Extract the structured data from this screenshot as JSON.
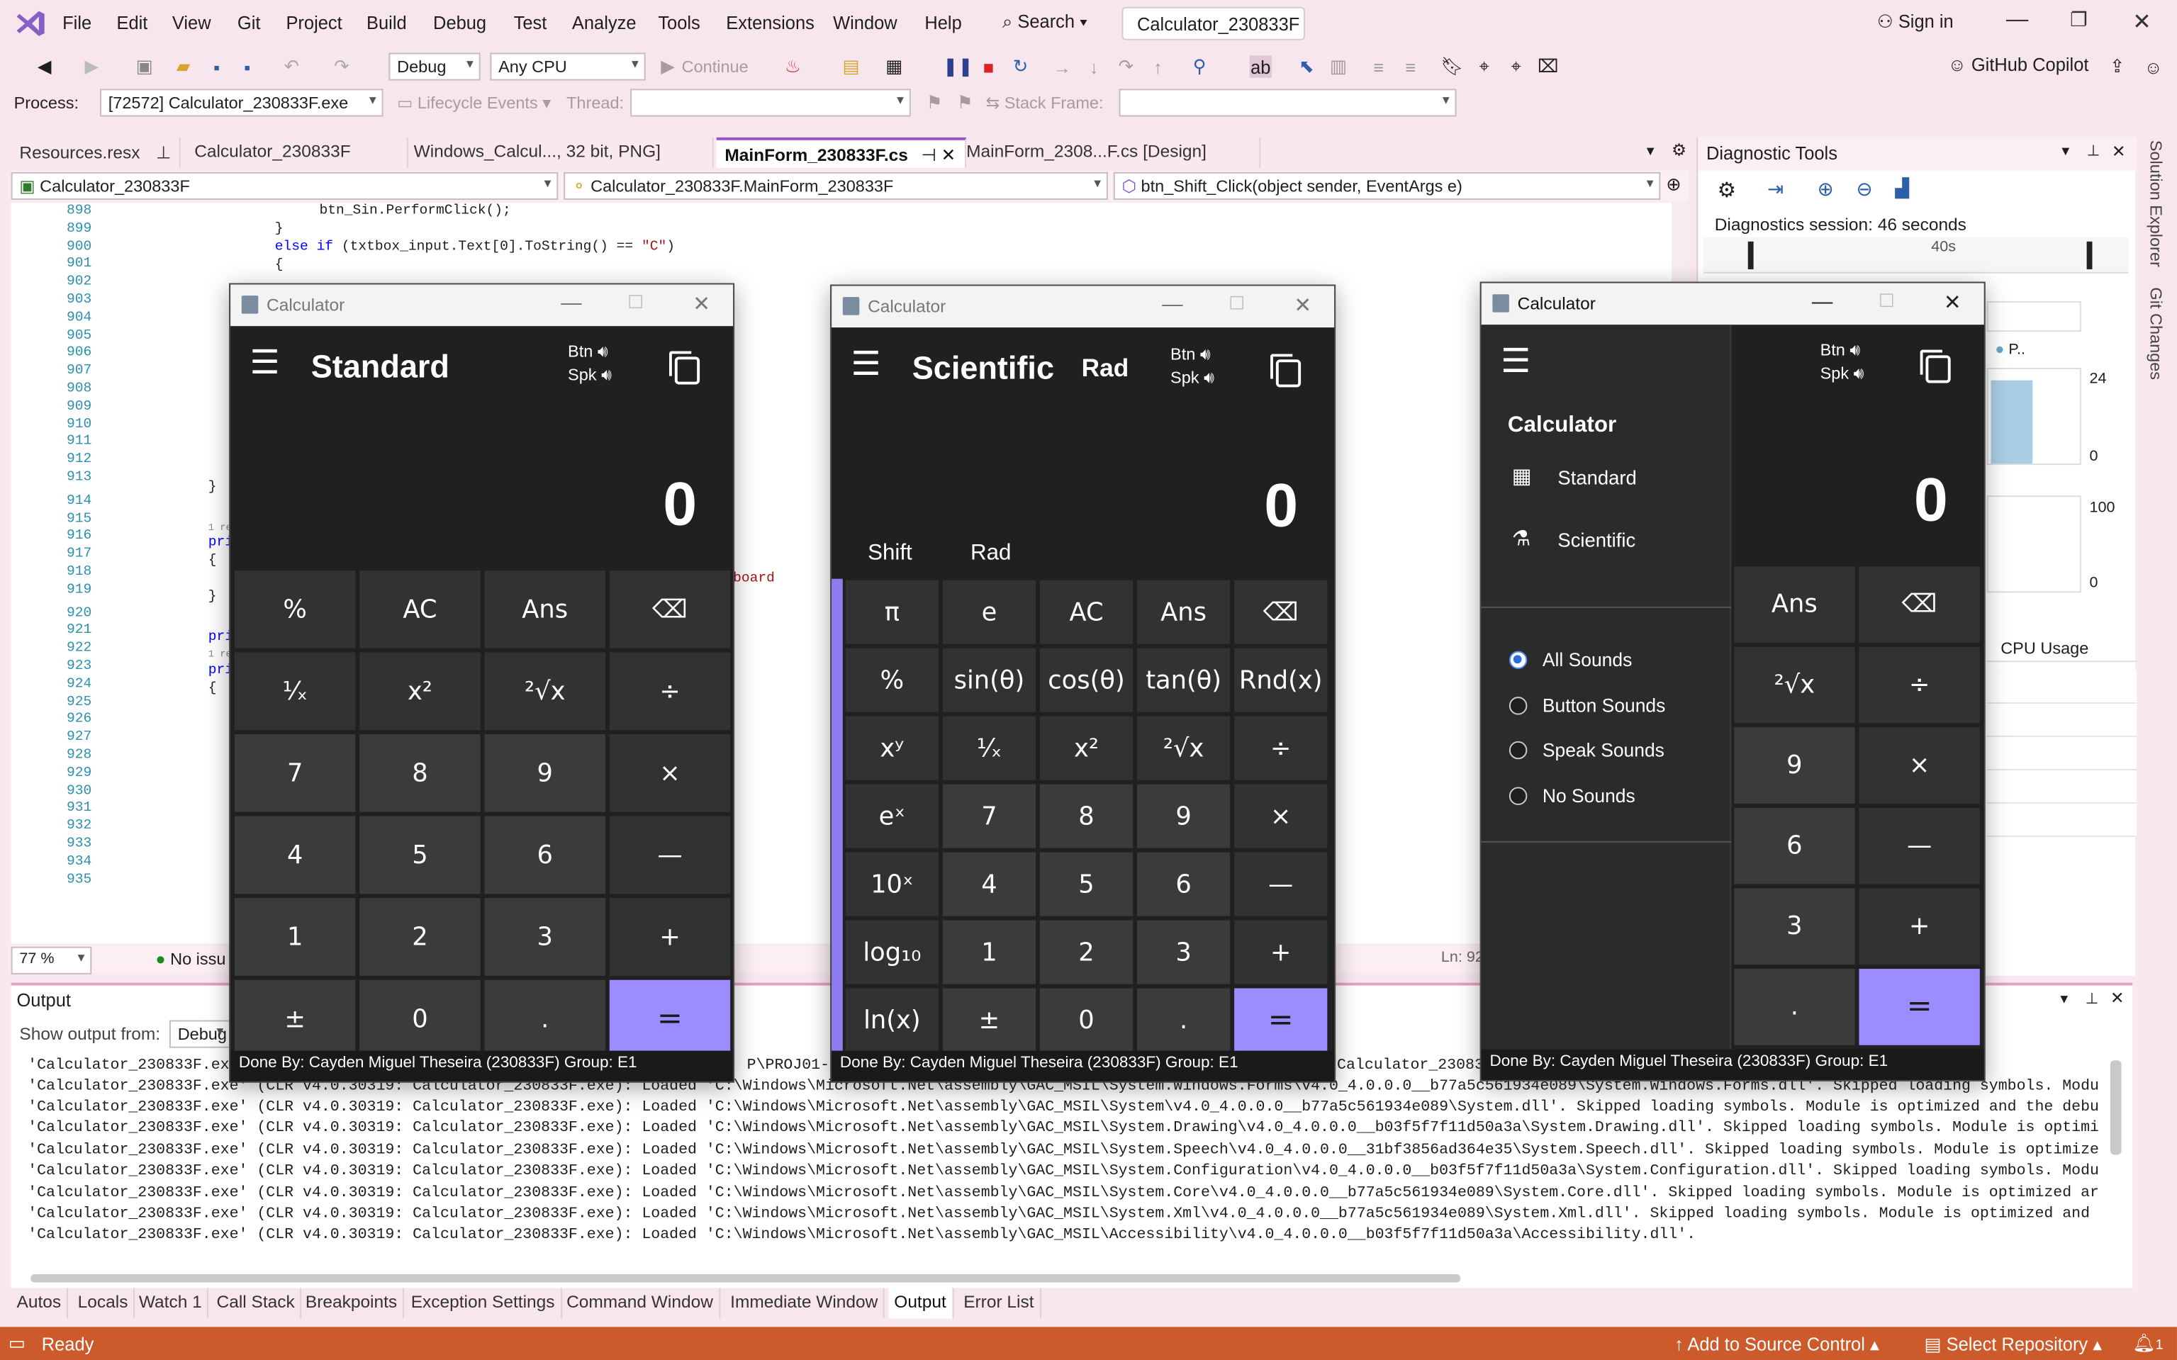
{
  "menu": [
    "File",
    "Edit",
    "View",
    "Git",
    "Project",
    "Build",
    "Debug",
    "Test",
    "Analyze",
    "Tools",
    "Extensions",
    "Window",
    "Help"
  ],
  "search_label": "Search",
  "window_title": "Calculator_230833F",
  "sign_in": "Sign in",
  "copilot": "GitHub Copilot",
  "toolbar": {
    "config": "Debug",
    "platform": "Any CPU",
    "continue": "Continue"
  },
  "debugbar": {
    "process_label": "Process:",
    "process_value": "[72572] Calculator_230833F.exe",
    "lifecycle": "Lifecycle Events",
    "thread_label": "Thread:",
    "stackframe_label": "Stack Frame:"
  },
  "doc_tabs": [
    "Resources.resx",
    "Calculator_230833F",
    "Windows_Calcul..., 32 bit, PNG]",
    "MainForm_230833F.cs",
    "MainForm_2308...F.cs [Design]"
  ],
  "nav": {
    "project": "Calculator_230833F",
    "class": "Calculator_230833F.MainForm_230833F",
    "member": "btn_Shift_Click(object sender, EventArgs e)"
  },
  "code": {
    "lines": [
      "898",
      "899",
      "900",
      "901",
      "902",
      "903",
      "904",
      "905",
      "906",
      "907",
      "908",
      "909",
      "910",
      "911",
      "912",
      "913",
      "914",
      "915",
      "916",
      "917",
      "918",
      "919",
      "920",
      "921",
      "922",
      "923",
      "924",
      "925",
      "926",
      "927",
      "928",
      "929",
      "930",
      "931",
      "932",
      "933",
      "934",
      "935"
    ],
    "l898": "btn_Sin.PerformClick();",
    "l899": "}",
    "l900_kw": "else if",
    "l900_a": " (txtbox_input.Text[0].ToString() == ",
    "l900_str": "\"C\"",
    "l900_b": ")",
    "l901": "{",
    "l913": "}",
    "refs": "1 re",
    "l915": "pri",
    "l916": "{",
    "l917_frag": "board",
    "l918": "}",
    "l920": "pri",
    "l921": "pri",
    "l922": "{"
  },
  "editor_status": {
    "zoom": "77 %",
    "issues": "No issu",
    "ln": "Ln: 92"
  },
  "diagnostics": {
    "title": "Diagnostic Tools",
    "session": "Diagnostics session: 46 seconds",
    "tick": "40s",
    "proc_label": "P..",
    "y1_top": "24",
    "y1_bot": "0",
    "y2_top": "100",
    "y2_bot": "0",
    "cpu_tab": "CPU Usage"
  },
  "side_tabs": [
    "Solution Explorer",
    "Git Changes"
  ],
  "output": {
    "title": "Output",
    "show_from": "Show output from:",
    "source": "Debug",
    "line_head1": "'Calculator_230833F.ex",
    "line_head1_tail": "P\\PROJ01-E",
    "line_head1_tail2": "Calculator_230833F",
    "line_head2": "'Calculator_230833F.exe' (CLR v4.0.30319: Calculator_230833F.exe): Loaded 'C:\\Windows\\Microsoft.Net\\assembly\\GAC_MSIL\\System.Windows.Forms\\v4.0_4.0.0.0__b77a5c561934e089\\System.Windows.Forms.dll'. Skipped loading symbols. Modu",
    "lines": [
      "'Calculator_230833F.exe' (CLR v4.0.30319: Calculator_230833F.exe): Loaded 'C:\\Windows\\Microsoft.Net\\assembly\\GAC_MSIL\\System\\v4.0_4.0.0.0__b77a5c561934e089\\System.dll'. Skipped loading symbols. Module is optimized and the debu",
      "'Calculator_230833F.exe' (CLR v4.0.30319: Calculator_230833F.exe): Loaded 'C:\\Windows\\Microsoft.Net\\assembly\\GAC_MSIL\\System.Drawing\\v4.0_4.0.0.0__b03f5f7f11d50a3a\\System.Drawing.dll'. Skipped loading symbols. Module is optimi",
      "'Calculator_230833F.exe' (CLR v4.0.30319: Calculator_230833F.exe): Loaded 'C:\\Windows\\Microsoft.Net\\assembly\\GAC_MSIL\\System.Speech\\v4.0_4.0.0.0__31bf3856ad364e35\\System.Speech.dll'. Skipped loading symbols. Module is optimize",
      "'Calculator_230833F.exe' (CLR v4.0.30319: Calculator_230833F.exe): Loaded 'C:\\Windows\\Microsoft.Net\\assembly\\GAC_MSIL\\System.Configuration\\v4.0_4.0.0.0__b03f5f7f11d50a3a\\System.Configuration.dll'. Skipped loading symbols. Modu",
      "'Calculator_230833F.exe' (CLR v4.0.30319: Calculator_230833F.exe): Loaded 'C:\\Windows\\Microsoft.Net\\assembly\\GAC_MSIL\\System.Core\\v4.0_4.0.0.0__b77a5c561934e089\\System.Core.dll'. Skipped loading symbols. Module is optimized ar",
      "'Calculator_230833F.exe' (CLR v4.0.30319: Calculator_230833F.exe): Loaded 'C:\\Windows\\Microsoft.Net\\assembly\\GAC_MSIL\\System.Xml\\v4.0_4.0.0.0__b77a5c561934e089\\System.Xml.dll'. Skipped loading symbols. Module is optimized and",
      "'Calculator_230833F.exe' (CLR v4.0.30319: Calculator_230833F.exe): Loaded 'C:\\Windows\\Microsoft.Net\\assembly\\GAC_MSIL\\Accessibility\\v4.0_4.0.0.0__b03f5f7f11d50a3a\\Accessibility.dll'."
    ]
  },
  "bottom_tabs": [
    "Autos",
    "Locals",
    "Watch 1",
    "Call Stack",
    "Breakpoints",
    "Exception Settings",
    "Command Window",
    "Immediate Window",
    "Output",
    "Error List"
  ],
  "status": {
    "ready": "Ready",
    "source_control": "Add to Source Control",
    "repo": "Select Repository",
    "notif": "1"
  },
  "calc_common": {
    "title": "Calculator",
    "btn": "Btn",
    "spk": "Spk",
    "display": "0",
    "footer": "Done By: Cayden Miguel Theseira (230833F) Group: E1"
  },
  "calc_std": {
    "mode": "Standard",
    "keys": [
      "%",
      "AC",
      "Ans",
      "⌫",
      "¹⁄ₓ",
      "x²",
      "²√x",
      "÷",
      "7",
      "8",
      "9",
      "×",
      "4",
      "5",
      "6",
      "—",
      "1",
      "2",
      "3",
      "+",
      "±",
      "0",
      ".",
      "="
    ]
  },
  "calc_sci": {
    "mode": "Scientific",
    "angle": "Rad",
    "shift": "Shift",
    "rad": "Rad",
    "keys": [
      "π",
      "e",
      "AC",
      "Ans",
      "⌫",
      "%",
      "sin(θ)",
      "cos(θ)",
      "tan(θ)",
      "Rnd(x)",
      "xʸ",
      "¹⁄ₓ",
      "x²",
      "²√x",
      "÷",
      "eˣ",
      "7",
      "8",
      "9",
      "×",
      "10ˣ",
      "4",
      "5",
      "6",
      "—",
      "log₁₀",
      "1",
      "2",
      "3",
      "+",
      "ln(x)",
      "±",
      "0",
      ".",
      "="
    ]
  },
  "calc_menu": {
    "heading": "Calculator",
    "nav_standard": "Standard",
    "nav_scientific": "Scientific",
    "sounds": [
      "All Sounds",
      "Button Sounds",
      "Speak Sounds",
      "No Sounds"
    ],
    "selected_sound": "All Sounds",
    "keys": [
      "Ans",
      "⌫",
      "²√x",
      "÷",
      "9",
      "×",
      "6",
      "—",
      "3",
      "+",
      ".",
      "="
    ]
  },
  "colors": {
    "accent": "#9b8cff",
    "status": "#cd5a2a",
    "ide_bg": "#f7e6ee"
  }
}
